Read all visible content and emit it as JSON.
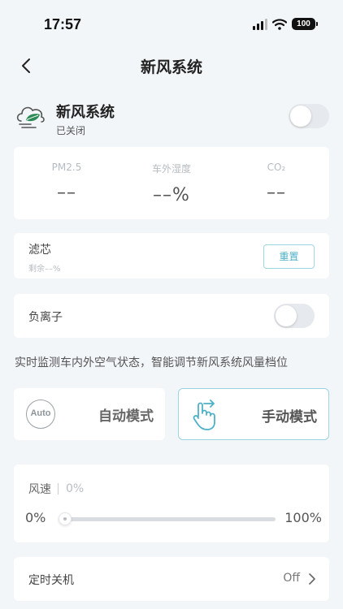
{
  "status": {
    "time": "17:57",
    "battery": "100"
  },
  "nav": {
    "title": "新风系统"
  },
  "device": {
    "name": "新风系统",
    "state": "已关闭"
  },
  "stats": [
    {
      "label": "PM2.5",
      "value": "––"
    },
    {
      "label": "车外湿度",
      "value": "––%"
    },
    {
      "label": "CO₂",
      "value": "––"
    }
  ],
  "filter": {
    "title": "滤芯",
    "remaining": "剩余––%",
    "reset_label": "重置"
  },
  "ion": {
    "label": "负离子"
  },
  "description": "实时监测车内外空气状态，智能调节新风系统风量档位",
  "modes": {
    "auto_icon_text": "Auto",
    "auto_label": "自动模式",
    "manual_label": "手动模式",
    "selected": "manual"
  },
  "speed": {
    "label": "风速",
    "value": "0%",
    "min": "0%",
    "max": "100%",
    "level": 0
  },
  "timer": {
    "label": "定时关机",
    "value": "Off"
  },
  "colors": {
    "accent": "#4db0c8",
    "leaf": "#2e8b57",
    "background": "#f3f6f9"
  },
  "icons": {
    "back": "chevron-left-icon",
    "device": "cloud-leaf-icon",
    "manual": "hand-pointer-icon",
    "timer": "chevron-right-icon"
  }
}
